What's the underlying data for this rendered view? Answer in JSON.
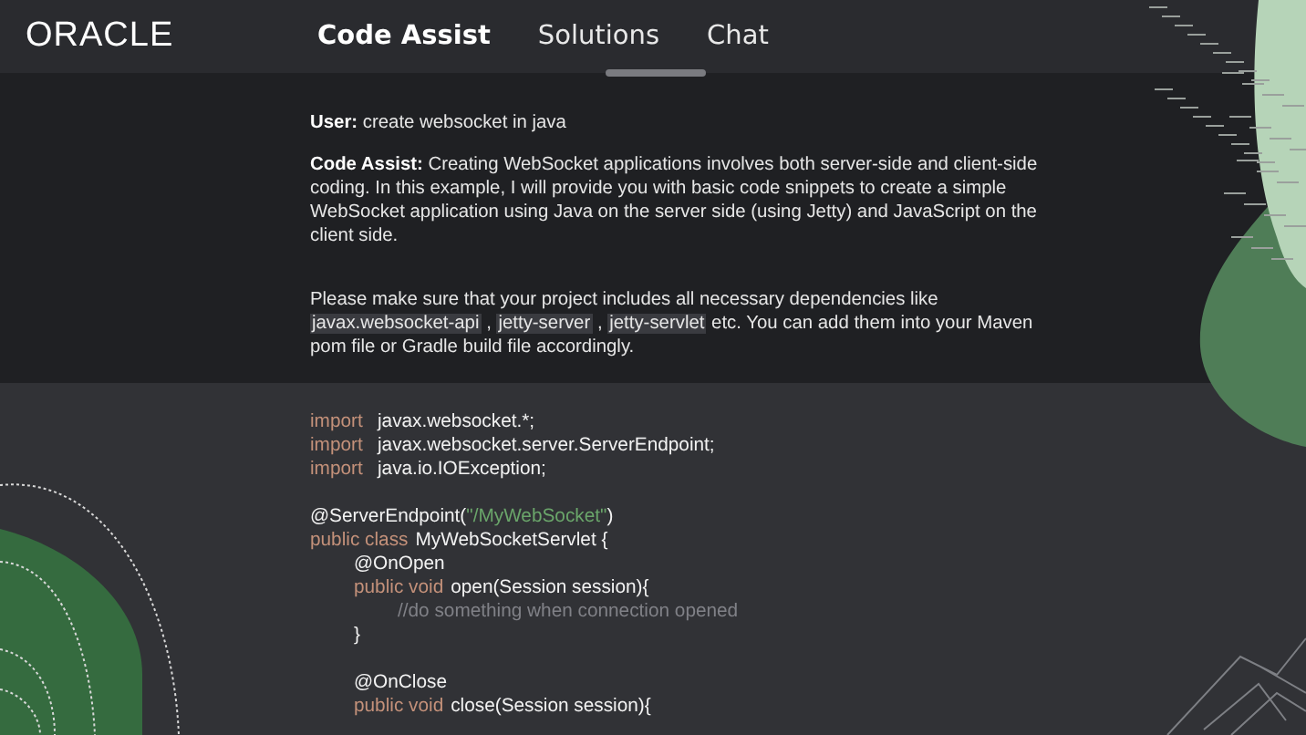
{
  "header": {
    "logo": "ORACLE",
    "nav": [
      {
        "label": "Code Assist",
        "selected": true
      },
      {
        "label": "Solutions",
        "selected": false
      },
      {
        "label": "Chat",
        "selected": false
      }
    ]
  },
  "chat": {
    "messages": [
      {
        "speaker": "User:",
        "parts": [
          {
            "kind": "text",
            "text": "create websocket in java"
          }
        ]
      },
      {
        "speaker": "Code Assist:",
        "parts": [
          {
            "kind": "text",
            "text": "Creating WebSocket applications involves both server-side and client-side coding. In this example, I will provide you with basic code snippets to create a simple WebSocket application using Java on the server side (using Jetty) and JavaScript on the client side."
          }
        ]
      },
      {
        "parts": [
          {
            "kind": "text",
            "text": "Please make sure that your project includes all necessary dependencies like "
          },
          {
            "kind": "code",
            "text": "javax.websocket-api"
          },
          {
            "kind": "text",
            "text": " , "
          },
          {
            "kind": "code",
            "text": "jetty-server"
          },
          {
            "kind": "text",
            "text": " , "
          },
          {
            "kind": "code",
            "text": "jetty-servlet"
          },
          {
            "kind": "text",
            "text": " etc. You can add them into your Maven pom file or Gradle build file accordingly."
          }
        ]
      }
    ]
  },
  "code": [
    {
      "tokens": [
        {
          "kind": "keyword",
          "text": "import"
        },
        {
          "kind": "plain",
          "text": "javax.websocket.*;"
        }
      ]
    },
    {
      "tokens": [
        {
          "kind": "keyword",
          "text": "import"
        },
        {
          "kind": "plain",
          "text": "javax.websocket.server.ServerEndpoint;"
        }
      ]
    },
    {
      "tokens": [
        {
          "kind": "keyword",
          "text": "import"
        },
        {
          "kind": "plain",
          "text": "java.io.IOException;"
        }
      ],
      "gap_after": true
    },
    {
      "tokens": [
        {
          "kind": "plain",
          "text": "@ServerEndpoint("
        },
        {
          "kind": "string",
          "text": "\"/MyWebSocket\""
        },
        {
          "kind": "plain",
          "text": ")"
        }
      ]
    },
    {
      "tokens": [
        {
          "kind": "keyword",
          "text": "public class"
        },
        {
          "kind": "plain",
          "text": "MyWebSocketServlet {"
        }
      ],
      "children": [
        {
          "tokens": [
            {
              "kind": "plain",
              "text": "@OnOpen"
            }
          ]
        },
        {
          "tokens": [
            {
              "kind": "keyword",
              "text": "public void"
            },
            {
              "kind": "plain",
              "text": "open(Session session){"
            }
          ],
          "children": [
            {
              "tokens": [
                {
                  "kind": "comment",
                  "text": "//do something when connection opened"
                }
              ]
            }
          ]
        },
        {
          "tokens": [
            {
              "kind": "plain",
              "text": "}"
            }
          ],
          "gap_after": true
        },
        {
          "tokens": [
            {
              "kind": "plain",
              "text": "@OnClose"
            }
          ]
        },
        {
          "tokens": [
            {
              "kind": "keyword",
              "text": "public void"
            },
            {
              "kind": "plain",
              "text": "close(Session session){"
            }
          ]
        }
      ]
    }
  ]
}
